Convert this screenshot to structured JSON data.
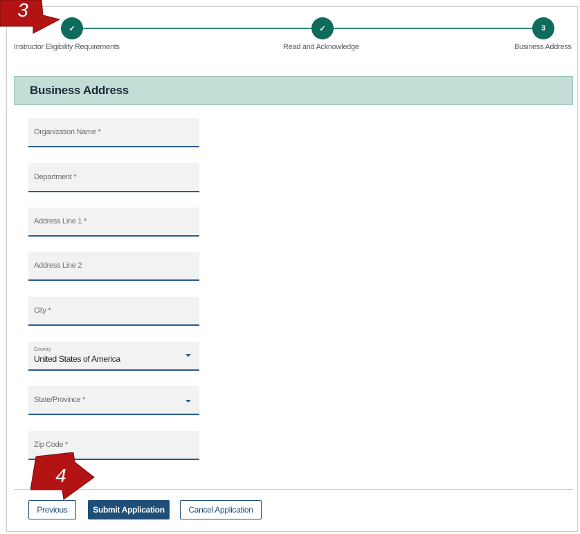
{
  "stepper": {
    "steps": [
      {
        "label": "Instructor Eligibility Requirements",
        "marker": "✓",
        "state": "complete"
      },
      {
        "label": "Read and Acknowledge",
        "marker": "✓",
        "state": "complete"
      },
      {
        "label": "Business Address",
        "marker": "3",
        "state": "current"
      }
    ]
  },
  "section": {
    "title": "Business Address"
  },
  "form": {
    "organization_name": {
      "label": "Organization Name *"
    },
    "department": {
      "label": "Department *"
    },
    "address_line_1": {
      "label": "Address Line 1 *"
    },
    "address_line_2": {
      "label": "Address Line 2"
    },
    "city": {
      "label": "City *"
    },
    "country": {
      "label": "Country",
      "value": "United States of America"
    },
    "state_province": {
      "label": "State/Province *"
    },
    "zip_code": {
      "label": "Zip Code *"
    }
  },
  "buttons": {
    "previous": "Previous",
    "submit": "Submit Application",
    "cancel": "Cancel Application"
  },
  "callouts": {
    "step_callout": "3",
    "submit_callout": "4"
  },
  "colors": {
    "step_complete": "#0f6b5b",
    "header_bg": "#c3ddd7",
    "primary": "#1f4e79",
    "field_underline": "#2a5a8f",
    "callout": "#b31313"
  }
}
